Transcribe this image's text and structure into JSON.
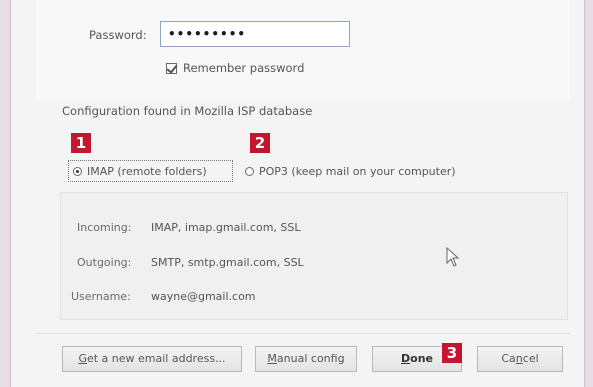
{
  "account": {
    "password_label": "Password:",
    "password_value": "•••••••••",
    "remember_label": "Remember password",
    "remember_checked": true
  },
  "config": {
    "found_text": "Configuration found in Mozilla ISP database"
  },
  "annotations": {
    "badge_1": "1",
    "badge_2": "2",
    "badge_3": "3",
    "badge_color": "#c4162e"
  },
  "protocol": {
    "imap_label": "IMAP (remote folders)",
    "pop3_label": "POP3 (keep mail on your computer)",
    "selected": "imap"
  },
  "details": {
    "incoming_label": "Incoming:",
    "incoming_value": "IMAP, imap.gmail.com, SSL",
    "outgoing_label": "Outgoing:",
    "outgoing_value": "SMTP, smtp.gmail.com, SSL",
    "username_label": "Username:",
    "username_value": "wayne@gmail.com"
  },
  "buttons": {
    "new_email_first": "G",
    "new_email_rest": "et a new email address...",
    "manual_first": "M",
    "manual_rest": "anual config",
    "done_first": "D",
    "done_rest": "one",
    "cancel_first": "Ca",
    "cancel_u": "n",
    "cancel_rest": "cel"
  }
}
